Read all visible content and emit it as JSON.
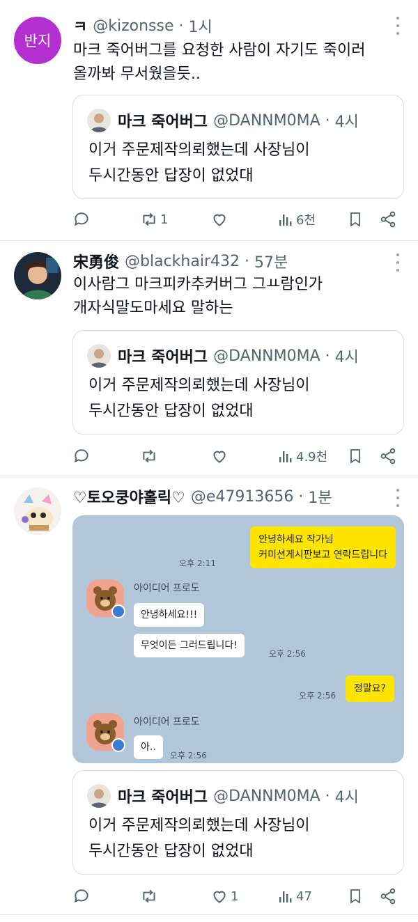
{
  "quoted_tweet": {
    "name": "마크 죽어버그",
    "handle": "@DANNM0MA",
    "time": "4시",
    "text_line1": "이거 주문제작의뢰했는데 사장님이",
    "text_line2": "두시간동안 답장이 없었대"
  },
  "tweets": [
    {
      "avatar_text": "반지",
      "avatar_color": "#b42fcf",
      "name": "ㅋ",
      "handle": "@kizonsse",
      "time": "1시",
      "text_line1": "마크 죽어버그를 요청한 사람이 자기도 죽이러",
      "text_line2": "올까봐 무서웠을듯..",
      "retweets": "1",
      "likes": "",
      "views": "6천"
    },
    {
      "name": "宋勇俊",
      "handle": "@blackhair432",
      "time": "57분",
      "text_line1": "이사람그 마크피카추커버그 그ㅛ람인가",
      "text_line2": "개자식말도마세요 말하는",
      "retweets": "",
      "likes": "",
      "views": "4.9천"
    },
    {
      "name": "♡토오쿵야홀릭♡",
      "handle": "@e47913656",
      "time": "1분",
      "retweets": "",
      "likes": "1",
      "views": "47"
    }
  ],
  "chat": {
    "msg1_line1": "안녕하세요 작가님",
    "msg1_line2": "커미션게시판보고 연락드립니다",
    "msg1_time": "오후 2:11",
    "sender_name": "아이디어 프로도",
    "reply1": "안녕하세요!!!",
    "reply2": "무엇이든 그러드립니다!",
    "reply2_time": "오후 2:56",
    "msg2": "정말요?",
    "msg2_time": "오후 2:56",
    "sender_name2": "아이디어 프로도",
    "reply3": "아..",
    "reply3_time": "오후 2:56"
  },
  "colors": {
    "accent_text": "#536471",
    "kakao_yellow": "#fee500",
    "chat_bg": "#b2c6d9"
  }
}
